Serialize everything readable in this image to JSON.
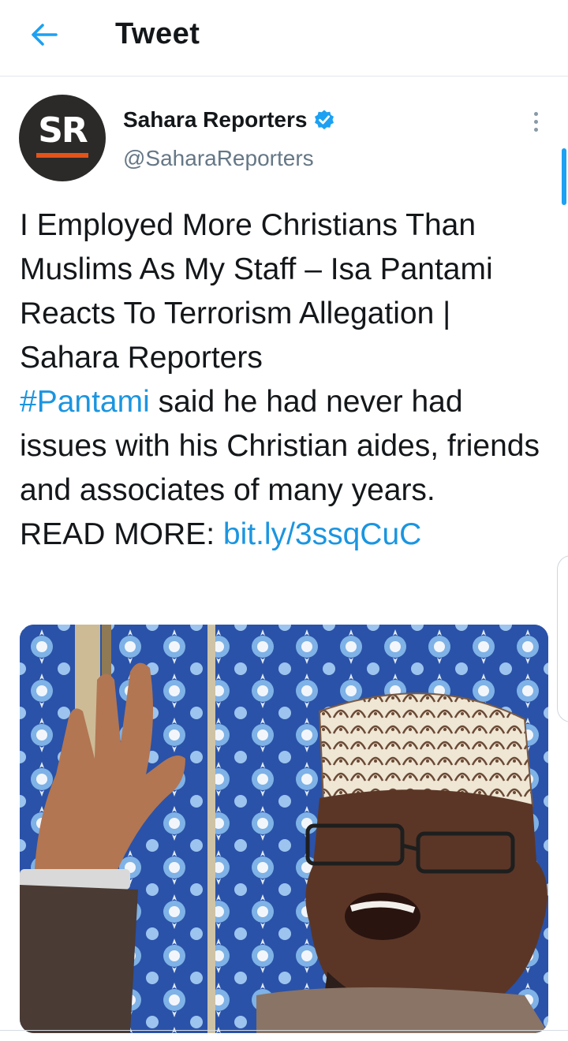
{
  "header": {
    "title": "Tweet",
    "back_icon": "arrow-left-icon"
  },
  "author": {
    "avatar_text": "SR",
    "name": "Sahara Reporters",
    "handle": "@SaharaReporters",
    "verified_icon": "verified-badge-icon"
  },
  "tweet": {
    "line1": "I Employed More Christians Than Muslims As My Staff – Isa Pantami Reacts To Terrorism Allegation | Sahara Reporters",
    "hashtag": "#Pantami",
    "line2_rest": " said he had never had issues with his Christian aides, friends and associates of many years.",
    "read_more_label": "READ MORE: ",
    "read_more_link": "bit.ly/3ssqCuC"
  },
  "media": {
    "icon": "tweet-photo"
  },
  "colors": {
    "accent": "#1da1f2",
    "link": "#1b95e0",
    "text": "#14171a",
    "secondary": "#657786",
    "brand_orange": "#e3531a"
  }
}
